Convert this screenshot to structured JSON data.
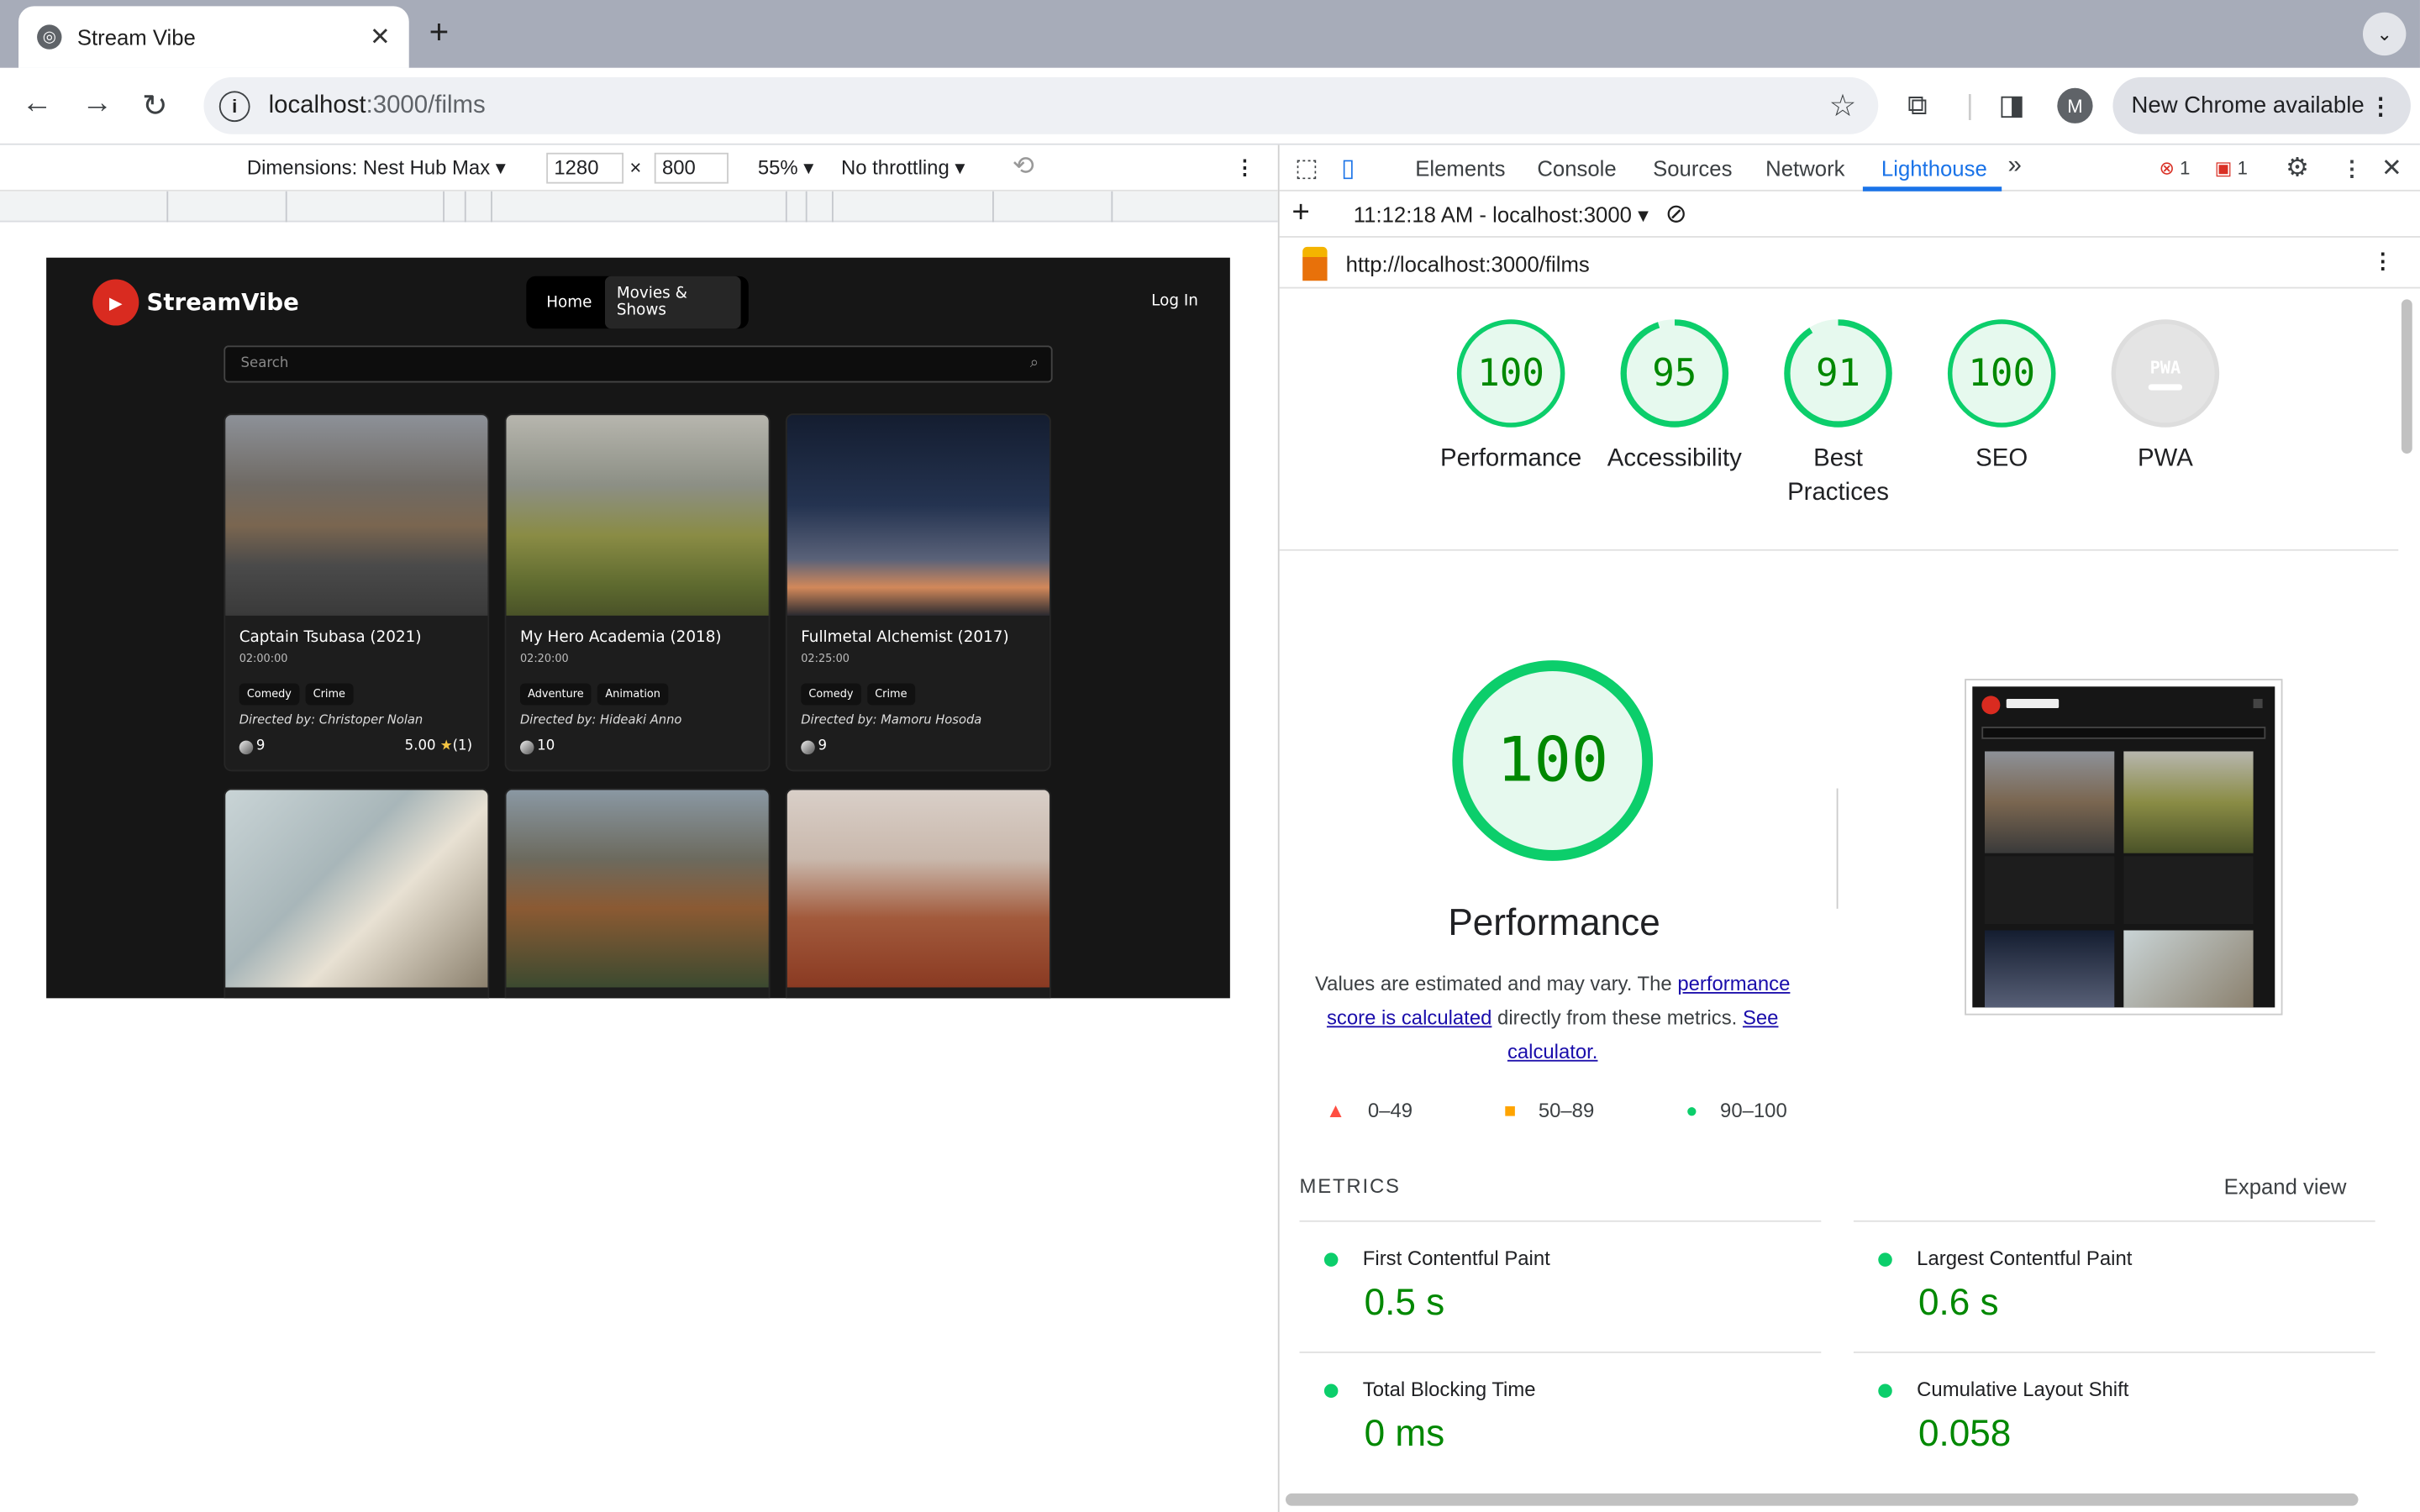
{
  "browser": {
    "tab_title": "Stream Vibe",
    "url_host": "localhost",
    "url_path": ":3000/films",
    "new_chrome": "New Chrome available",
    "profile_initial": "M"
  },
  "device_toolbar": {
    "dimensions": "Dimensions: Nest Hub Max",
    "width": "1280",
    "times": "×",
    "height": "800",
    "zoom": "55%",
    "throttling": "No throttling"
  },
  "site": {
    "logo": "StreamVibe",
    "nav": [
      "Home",
      "Movies & Shows"
    ],
    "login": "Log In",
    "search_placeholder": "Search",
    "cards": [
      {
        "title": "Captain Tsubasa (2021)",
        "duration": "02:00:00",
        "tags": [
          "Comedy",
          "Crime"
        ],
        "director": "Directed by: Christoper Nolan",
        "votes": "9",
        "rating": "5.00",
        "rating_count": "(1)"
      },
      {
        "title": "My Hero Academia (2018)",
        "duration": "02:20:00",
        "tags": [
          "Adventure",
          "Animation"
        ],
        "director": "Directed by: Hideaki Anno",
        "votes": "10",
        "rating": "",
        "rating_count": ""
      },
      {
        "title": "Fullmetal Alchemist (2017)",
        "duration": "02:25:00",
        "tags": [
          "Comedy",
          "Crime"
        ],
        "director": "Directed by: Mamoru Hosoda",
        "votes": "9",
        "rating": "",
        "rating_count": ""
      }
    ]
  },
  "devtools": {
    "tabs": [
      "Elements",
      "Console",
      "Sources",
      "Network",
      "Lighthouse"
    ],
    "active_tab": "Lighthouse",
    "error_count": "1",
    "issue_count": "1",
    "report_selector": "11:12:18 AM - localhost:3000",
    "report_url": "http://localhost:3000/films"
  },
  "lighthouse": {
    "scores": [
      {
        "value": "100",
        "label": "Performance"
      },
      {
        "value": "95",
        "label": "Accessibility"
      },
      {
        "value": "91",
        "label": "Best Practices"
      },
      {
        "value": "100",
        "label": "SEO"
      },
      {
        "value": "",
        "label": "PWA"
      }
    ],
    "perf_score": "100",
    "perf_title": "Performance",
    "desc_1": "Values are estimated and may vary. The ",
    "desc_link1": "performance score is calculated",
    "desc_2": " directly from these metrics. ",
    "desc_link2": "See calculator.",
    "legend": [
      "0–49",
      "50–89",
      "90–100"
    ],
    "metrics_header": "METRICS",
    "expand": "Expand view",
    "metrics": [
      {
        "name": "First Contentful Paint",
        "value": "0.5 s"
      },
      {
        "name": "Largest Contentful Paint",
        "value": "0.6 s"
      },
      {
        "name": "Total Blocking Time",
        "value": "0 ms"
      },
      {
        "name": "Cumulative Layout Shift",
        "value": "0.058"
      }
    ]
  },
  "colors": {
    "pass": "#0cce6b",
    "average": "#ffa400",
    "fail": "#ff4e42",
    "accent": "#1a73e8",
    "site_bg": "#161616"
  }
}
